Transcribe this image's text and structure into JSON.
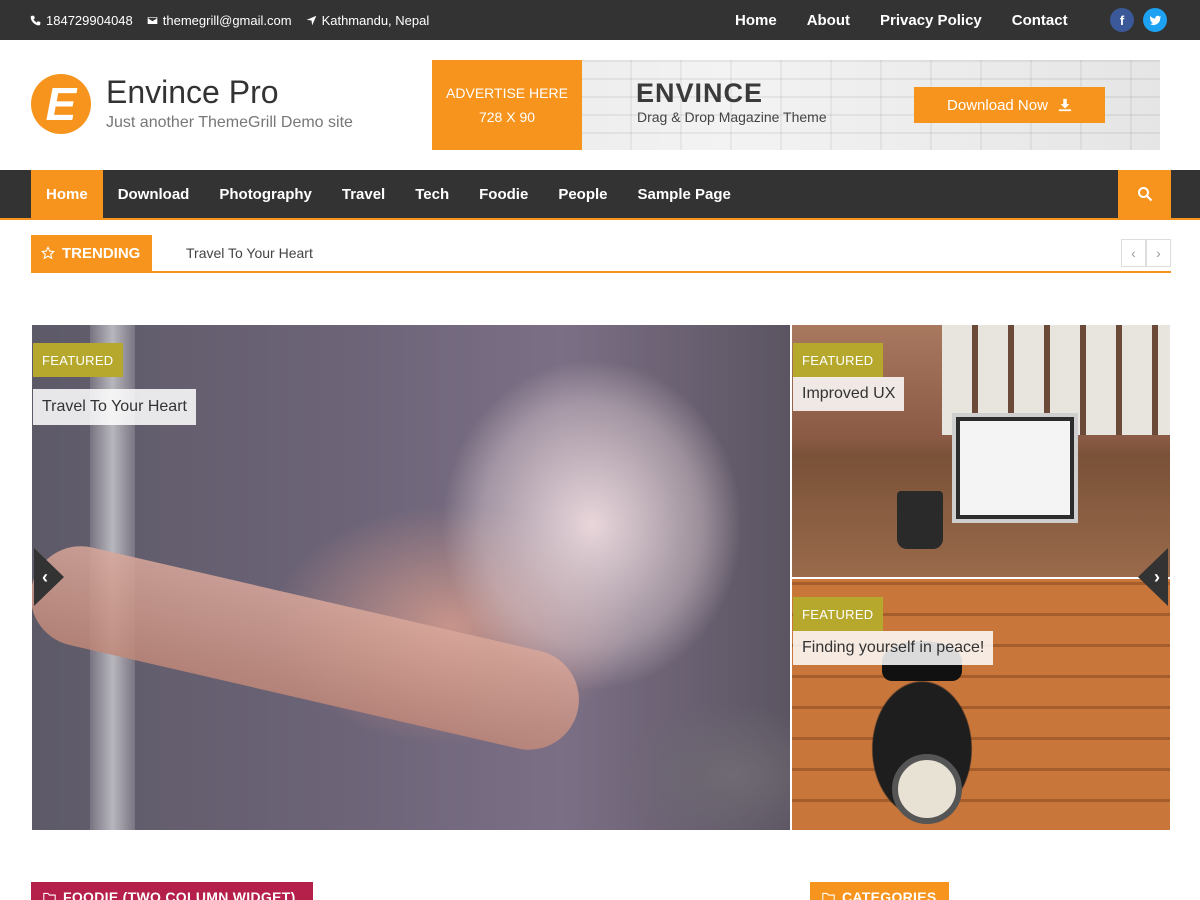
{
  "topbar": {
    "phone": "184729904048",
    "email": "themegrill@gmail.com",
    "location": "Kathmandu, Nepal",
    "nav": [
      "Home",
      "About",
      "Privacy Policy",
      "Contact"
    ],
    "social": [
      {
        "name": "facebook-icon",
        "glyph": "f",
        "color": "#3b5998"
      },
      {
        "name": "twitter-icon",
        "glyph": "t",
        "color": "#1da1f2"
      }
    ]
  },
  "header": {
    "logo_letter": "E",
    "site_title": "Envince Pro",
    "tagline": "Just another ThemeGrill Demo site",
    "ad": {
      "line1": "ADVERTISE HERE",
      "line2": "728 X 90",
      "brand": "ENVINCE",
      "subtitle": "Drag & Drop Magazine Theme",
      "button": "Download Now"
    }
  },
  "mainnav": {
    "items": [
      "Home",
      "Download",
      "Photography",
      "Travel",
      "Tech",
      "Foodie",
      "People",
      "Sample Page"
    ],
    "active_index": 0
  },
  "trending": {
    "label": "TRENDING",
    "headline": "Travel To Your Heart",
    "prev": "‹",
    "next": "›"
  },
  "slider": {
    "prev": "‹",
    "next": "›",
    "main": {
      "badge": "FEATURED",
      "title": "Travel To Your Heart"
    },
    "side": [
      {
        "badge": "FEATURED",
        "title": "Improved UX"
      },
      {
        "badge": "FEATURED",
        "title": "Finding yourself in peace!"
      }
    ]
  },
  "widgets": {
    "foodie_title": "FOODIE (TWO COLUMN WIDGET)",
    "categories_title": "CATEGORIES"
  },
  "colors": {
    "accent": "#f7941d",
    "dark": "#333333",
    "badge": "#b5a82c",
    "foodie": "#b5204b"
  }
}
